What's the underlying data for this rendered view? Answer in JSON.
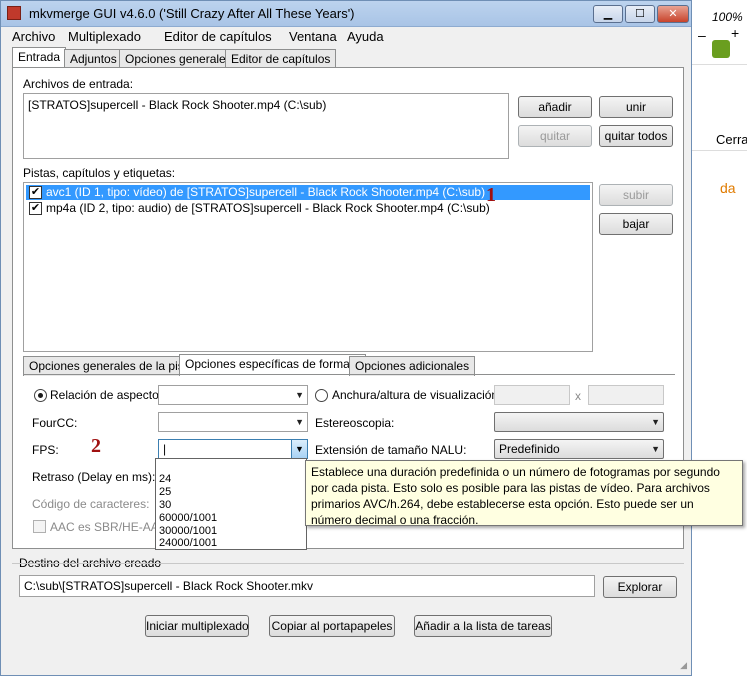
{
  "window": {
    "title": "mkvmerge GUI v4.6.0 ('Still Crazy After All These Years')",
    "minimize": "▁",
    "maximize": "☐",
    "close": "✕"
  },
  "menu": [
    "Archivo",
    "Multiplexado",
    "Editor de capítulos",
    "Ventana",
    "Ayuda"
  ],
  "main_tabs": [
    "Entrada",
    "Adjuntos",
    "Opciones generales",
    "Editor de capítulos"
  ],
  "input": {
    "files_label": "Archivos de entrada:",
    "files": [
      "[STRATOS]supercell - Black Rock Shooter.mp4 (C:\\sub)"
    ],
    "add": "añadir",
    "join": "unir",
    "remove": "quitar",
    "remove_all": "quitar todos"
  },
  "tracks": {
    "label": "Pistas, capítulos y etiquetas:",
    "items": [
      {
        "text": "avc1 (ID 1, tipo: vídeo) de [STRATOS]supercell - Black Rock Shooter.mp4 (C:\\sub)",
        "checked": true,
        "selected": true
      },
      {
        "text": "mp4a (ID 2, tipo: audio) de [STRATOS]supercell - Black Rock Shooter.mp4 (C:\\sub)",
        "checked": true,
        "selected": false
      }
    ],
    "up": "subir",
    "down": "bajar",
    "annotation_1": "1"
  },
  "sub_tabs": [
    "Opciones generales de la pista",
    "Opciones específicas de formato",
    "Opciones adicionales"
  ],
  "format": {
    "aspect_ratio": "Relación de aspecto:",
    "display_wh": "Anchura/altura de visualización:",
    "x": "x",
    "fourcc": "FourCC:",
    "stereo": "Estereoscopia:",
    "fps": "FPS:",
    "fps_value": "|",
    "annotation_2": "2",
    "nalu": "Extensión de tamaño NALU:",
    "nalu_value": "Predefinido",
    "delay": "Retraso (Delay en ms):",
    "charset": "Código de caracteres:",
    "aac": "AAC es SBR/HE-AAC/A",
    "fps_options": [
      "",
      "24",
      "25",
      "30",
      "60000/1001",
      "30000/1001",
      "24000/1001"
    ],
    "tooltip": "Establece una duración predefinida o un número de fotogramas por segundo por cada pista. Esto solo es posible para las pistas de vídeo. Para archivos primarios AVC/h.264, debe establecerse esta opción. Esto puede ser un número decimal o una fracción."
  },
  "output": {
    "label": "Destino del archivo creado",
    "path": "C:\\sub\\[STRATOS]supercell - Black Rock Shooter.mkv",
    "browse": "Explorar"
  },
  "actions": {
    "start": "Iniciar multiplexado",
    "copy": "Copiar al portapapeles",
    "queue": "Añadir a la lista de tareas"
  },
  "background": {
    "zoom": "100%",
    "minus": "–",
    "plus": "+",
    "close_partial": "Cerrar",
    "text_partial": "da"
  },
  "colors": {
    "selection": "#3399ff",
    "annotation": "#a01010",
    "tooltip_bg": "#ffffe1",
    "download_arrow": "#6a9e1f"
  }
}
